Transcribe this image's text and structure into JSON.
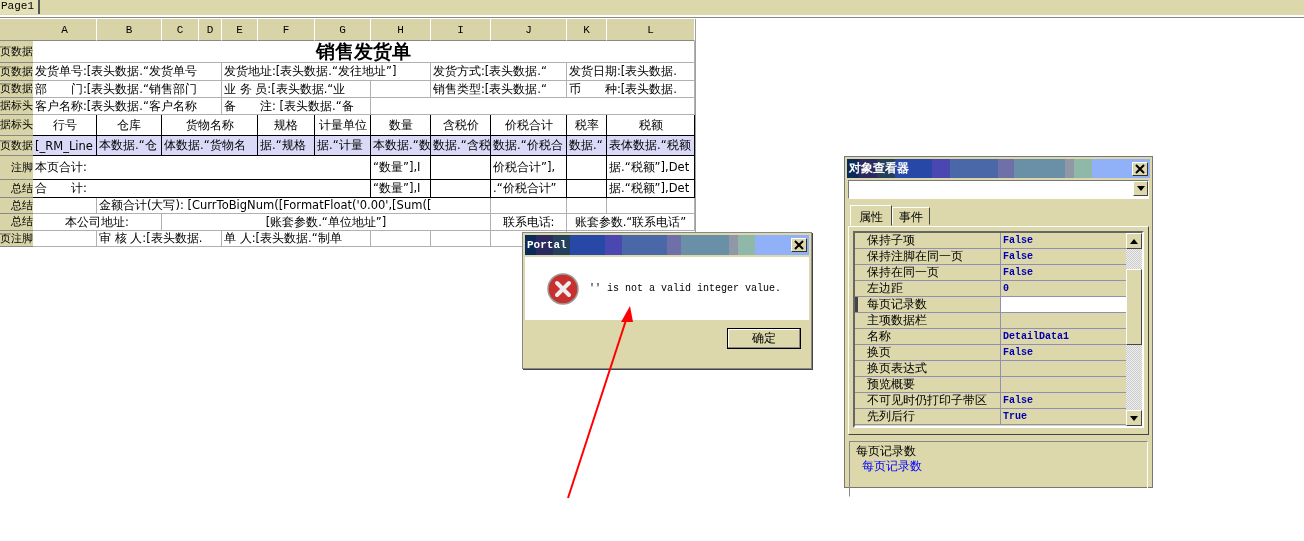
{
  "tab_bar": {
    "tabs": [
      {
        "label": "Page1",
        "selected": true
      }
    ]
  },
  "sheet": {
    "column_headers": [
      "A",
      "B",
      "C",
      "D",
      "E",
      "F",
      "G",
      "H",
      "I",
      "J",
      "K",
      "L"
    ],
    "bands": [
      {
        "label": "页数据",
        "selected": false,
        "cells": [
          "销售发货单"
        ]
      },
      {
        "label": "页数据",
        "selected": false,
        "cells": [
          "发货单号:[表头数据.“发货单号",
          "发货地址:[表头数据.“发往地址”]",
          "发货方式:[表头数据.“",
          "发货日期:[表头数据."
        ]
      },
      {
        "label": "页数据",
        "selected": false,
        "cells": [
          "部　　门:[表头数据.“销售部门",
          "业 务 员:[表头数据.“业",
          "销售类型:[表头数据.“",
          "币　　种:[表头数据."
        ]
      },
      {
        "label": "据标头",
        "selected": false,
        "cells": [
          "客户名称:[表头数据.“客户名称",
          "备　　注: [表头数据.“备"
        ]
      },
      {
        "label": "据标头",
        "selected": false,
        "cells": [
          "行号",
          "仓库",
          "货物名称",
          "规格",
          "计量单位",
          "数量",
          "含税价",
          "价税合计",
          "税率",
          "税额"
        ]
      },
      {
        "label": "页数据",
        "selected": true,
        "cells": [
          "[_RM_Line",
          "本数据.“仓",
          "体数据.“货物名",
          "据.“规格",
          "据.“计量",
          "本数据.“数",
          "数据.“含税",
          "数据.“价税合",
          "数据.“",
          "表体数据.“税额"
        ]
      },
      {
        "label": "注脚",
        "selected": false,
        "cells": [
          "本页合计:",
          "“数量”],I",
          "价税合计”],",
          "据.“税额”],Det"
        ]
      },
      {
        "label": "总结",
        "selected": false,
        "cells": [
          "合　　计:",
          "“数量”],I",
          ".“价税合计”",
          "据.“税额”],Det"
        ]
      },
      {
        "label": "总结",
        "selected": false,
        "cells": [
          "金额合计(大写): [CurrToBigNum([FormatFloat('0.00',[Sum(["
        ]
      },
      {
        "label": "总结",
        "selected": false,
        "cells": [
          "本公司地址:",
          "[账套参数.“单位地址”]",
          "联系电话:",
          "账套参数.“联系电话”"
        ]
      },
      {
        "label": "页注脚",
        "selected": false,
        "cells": [
          "审 核 人:[表头数据.",
          "单 人:[表头数据.“制单"
        ]
      }
    ]
  },
  "dialog": {
    "title": "Portal",
    "message": "'' is not a valid integer value.",
    "buttons": [
      "确定"
    ]
  },
  "inspector": {
    "title": "对象查看器",
    "tabs": [
      {
        "label": "属性",
        "selected": true
      },
      {
        "label": "事件",
        "selected": false
      }
    ],
    "properties": [
      {
        "name": "保持子项",
        "value": "False",
        "selected": false
      },
      {
        "name": "保持注脚在同一页",
        "value": "False",
        "selected": false
      },
      {
        "name": "保持在同一页",
        "value": "False",
        "selected": false
      },
      {
        "name": "左边距",
        "value": "0",
        "selected": false
      },
      {
        "name": "每页记录数",
        "selected": true
      },
      {
        "name": "主项数据栏",
        "selected": false
      },
      {
        "name": "名称",
        "value": "DetailData1",
        "selected": false
      },
      {
        "name": "换页",
        "value": "False",
        "selected": false
      },
      {
        "name": "换页表达式",
        "selected": false
      },
      {
        "name": "预览概要",
        "selected": false
      },
      {
        "name": "不可见时仍打印子带区",
        "value": "False",
        "selected": false
      },
      {
        "name": "先列后行",
        "value": "True",
        "selected": false
      }
    ],
    "description": {
      "title": "每页记录数",
      "text": "每页记录数"
    }
  }
}
